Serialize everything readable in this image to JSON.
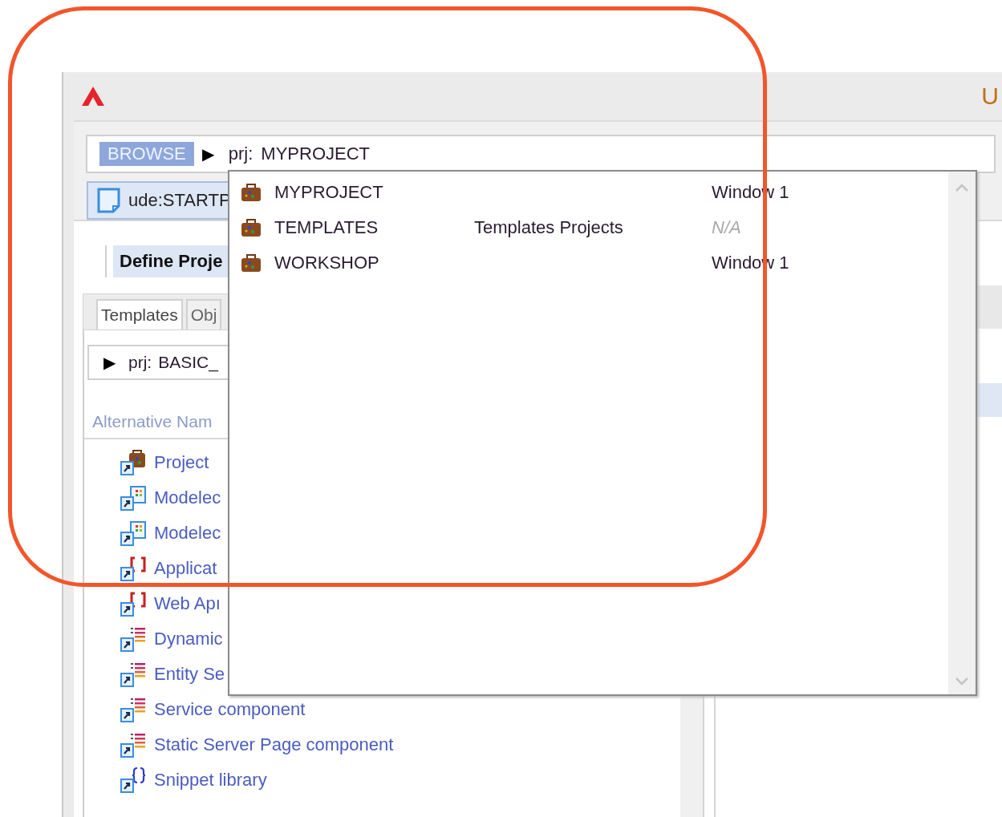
{
  "window": {
    "title_fragment": "U"
  },
  "browse_bar": {
    "badge": "BROWSE",
    "arrow": "▶",
    "prefix": "prj:",
    "value": "MYPROJECT"
  },
  "document_tab": {
    "label": "ude:STARTP"
  },
  "section_header": "Define Proje",
  "tabs": [
    {
      "label": "Templates",
      "selected": true
    },
    {
      "label": "Obj",
      "selected": false
    }
  ],
  "path_field": {
    "arrow": "▶",
    "prefix": "prj:",
    "value": "BASIC_"
  },
  "list_header": "Alternative Nam",
  "items": [
    {
      "kind": "project",
      "label": "Project"
    },
    {
      "kind": "model",
      "label": "Modelec"
    },
    {
      "kind": "model",
      "label": "Modelec"
    },
    {
      "kind": "application",
      "label": "Applicat"
    },
    {
      "kind": "application",
      "label": "Web Apı"
    },
    {
      "kind": "component",
      "label": "Dynamic"
    },
    {
      "kind": "component",
      "label": "Entity Se"
    },
    {
      "kind": "component",
      "label": "Service component"
    },
    {
      "kind": "component",
      "label": "Static Server Page component"
    },
    {
      "kind": "snippet",
      "label": "Snippet library"
    }
  ],
  "dropdown": {
    "rows": [
      {
        "name": "MYPROJECT",
        "description": "",
        "window": "Window 1",
        "disabled": false
      },
      {
        "name": "TEMPLATES",
        "description": "Templates Projects",
        "window": "N/A",
        "disabled": true
      },
      {
        "name": "WORKSHOP",
        "description": "",
        "window": "Window 1",
        "disabled": false
      }
    ]
  }
}
